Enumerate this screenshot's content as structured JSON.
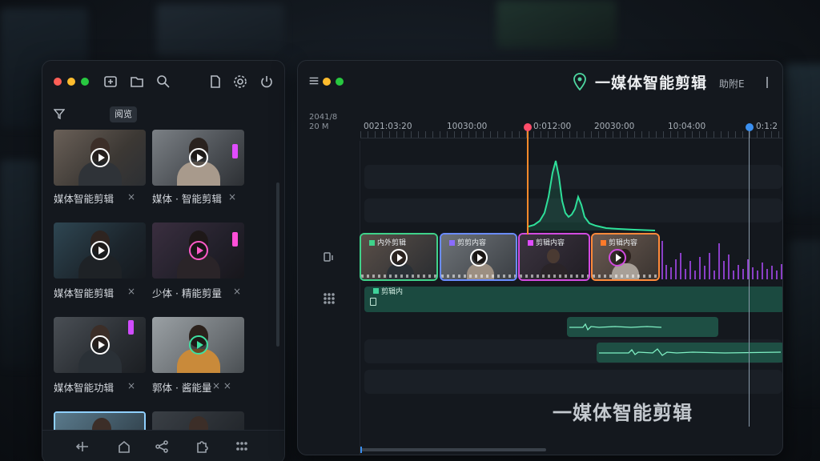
{
  "left_panel": {
    "filter_chip": "阅览",
    "thumbnails": [
      {
        "label": "媒体智能剪辑",
        "close": "×"
      },
      {
        "label": "媒体 · 智能剪辑",
        "close": "×"
      },
      {
        "label": "媒体智能剪辑",
        "close": "×"
      },
      {
        "label": "少体 · 精能剪量",
        "close": "×"
      },
      {
        "label": "媒体智能功辑",
        "close": "×"
      },
      {
        "label": "郭体 · 酱能量",
        "close": "× ×"
      }
    ]
  },
  "right_panel": {
    "title": "一媒体智能剪辑",
    "right_text": "助附E",
    "date_label_line1": "2041/8",
    "date_label_line2": "20 M",
    "ruler": [
      "0021:03:20",
      "10030:00",
      "0:012:00",
      "20030:00",
      "10:04:00",
      "0:1:2"
    ],
    "clips": [
      {
        "label": "内外剪辑",
        "color": "#3fd28a"
      },
      {
        "label": "剪剪内容",
        "color": "#6a8cff"
      },
      {
        "label": "剪辑内容",
        "color": "#d24be0"
      },
      {
        "label": "剪辑内容",
        "color": "#ff8a3a"
      }
    ],
    "audio_label": "剪辑内",
    "watermark": "一媒体智能剪辑"
  },
  "colors": {
    "green": "#3fd28a",
    "purple": "#b84bff",
    "orange": "#ff8a2a",
    "blue": "#3a8ff0"
  }
}
